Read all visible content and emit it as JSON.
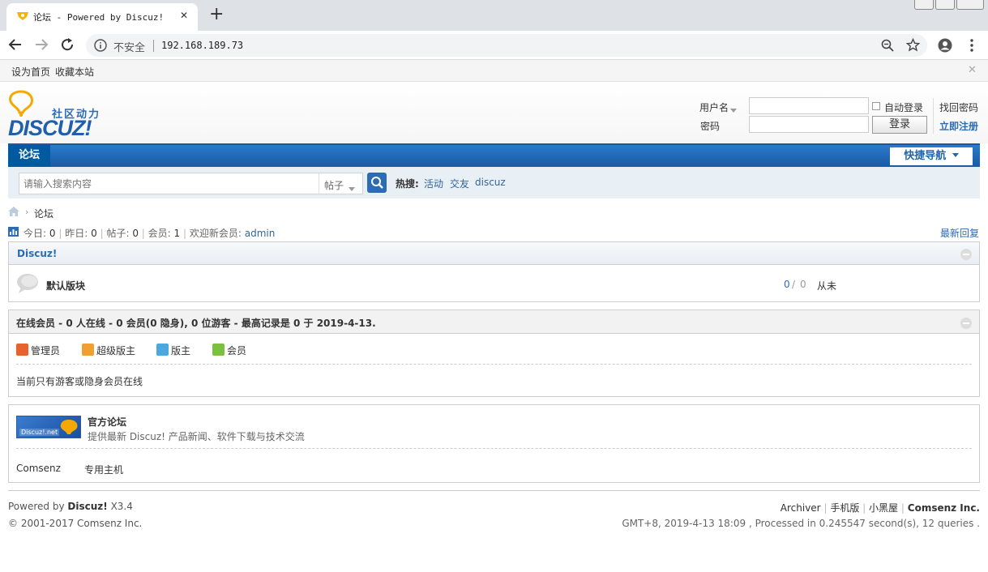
{
  "browser": {
    "tab_title": "论坛 - Powered by Discuz!",
    "new_tab": "+",
    "close_tab": "✕",
    "security_label": "不安全",
    "url": "192.168.189.73"
  },
  "topbar": {
    "set_home": "设为首页",
    "bookmark": "收藏本站",
    "close": "✕"
  },
  "logo": {
    "slogan": "社区动力",
    "brand": "DISCUZ!"
  },
  "login": {
    "username_label": "用户名",
    "password_label": "密码",
    "auto_login": "自动登录",
    "login_button": "登录",
    "forgot_password": "找回密码",
    "register": "立即注册"
  },
  "nav": {
    "current": "论坛",
    "quick_nav": "快捷导航"
  },
  "search": {
    "placeholder": "请输入搜索内容",
    "type": "帖子",
    "hot_label": "热搜:",
    "hot_terms": [
      "活动",
      "交友",
      "discuz"
    ]
  },
  "breadcrumb": {
    "current": "论坛"
  },
  "stats": {
    "today_label": "今日:",
    "today": "0",
    "yesterday_label": "昨日:",
    "yesterday": "0",
    "posts_label": "帖子:",
    "posts": "0",
    "members_label": "会员:",
    "members": "1",
    "newest_label": "欢迎新会员:",
    "newest": "admin",
    "latest_replies": "最新回复"
  },
  "category": {
    "title": "Discuz!",
    "forum": {
      "name": "默认版块",
      "threads": "0",
      "slash": "/",
      "posts": "0",
      "last_post": "从未"
    }
  },
  "online": {
    "title": "在线会员 - 0 人在线 - 0 会员(0 隐身), 0 位游客 - 最高记录是 0 于 2019-4-13.",
    "roles": [
      {
        "label": "管理员",
        "color": "#e8622e"
      },
      {
        "label": "超级版主",
        "color": "#f0a030"
      },
      {
        "label": "版主",
        "color": "#4aa8e0"
      },
      {
        "label": "会员",
        "color": "#7cc040"
      }
    ],
    "message": "当前只有游客或隐身会员在线"
  },
  "links": {
    "official_logo_text": "Discuz!.net",
    "official_title": "官方论坛",
    "official_desc": "提供最新 Discuz! 产品新闻、软件下载与技术交流",
    "text_links": [
      "Comsenz",
      "专用主机"
    ]
  },
  "footer": {
    "powered_prefix": "Powered by",
    "powered_brand": "Discuz!",
    "version": "X3.4",
    "copyright": "© 2001-2017 Comsenz Inc.",
    "links": [
      "Archiver",
      "手机版",
      "小黑屋"
    ],
    "company": "Comsenz Inc.",
    "debug": "GMT+8, 2019-4-13 18:09 , Processed in 0.245547 second(s), 12 queries ."
  }
}
